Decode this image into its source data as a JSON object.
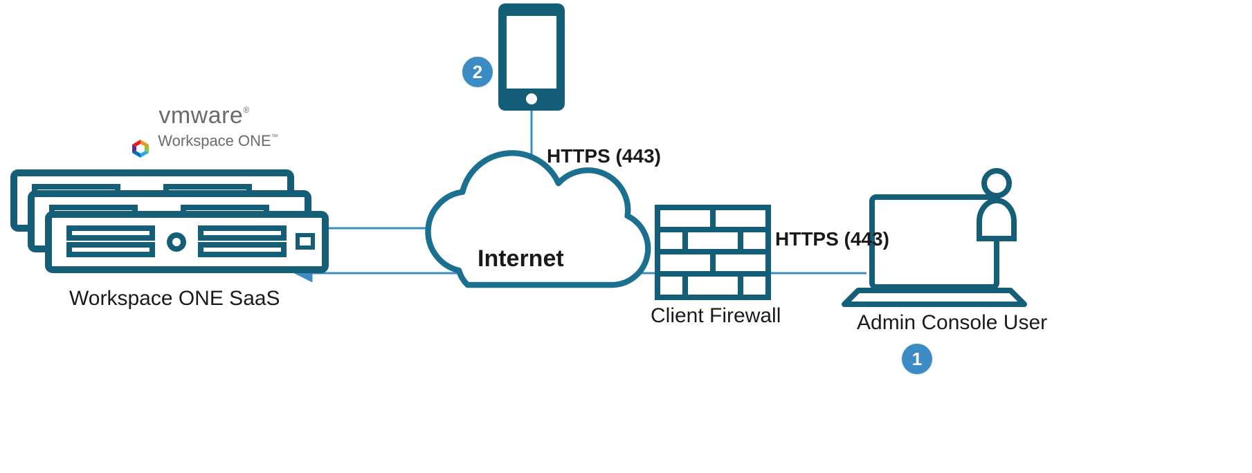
{
  "brand": {
    "vmware": "vmware",
    "workspace_one": "Workspace ONE"
  },
  "nodes": {
    "servers_label": "Workspace ONE SaaS",
    "cloud_label": "Internet",
    "firewall_label": "Client Firewall",
    "admin_label": "Admin Console User"
  },
  "connections": {
    "device_to_cloud": "HTTPS (443)",
    "admin_to_servers": "HTTPS (443)"
  },
  "badges": {
    "admin": "1",
    "device": "2"
  },
  "colors": {
    "stroke": "#1b6f8f",
    "fill_dark": "#155e78",
    "badge": "#3b8bc4",
    "line": "#3b8bc4"
  }
}
